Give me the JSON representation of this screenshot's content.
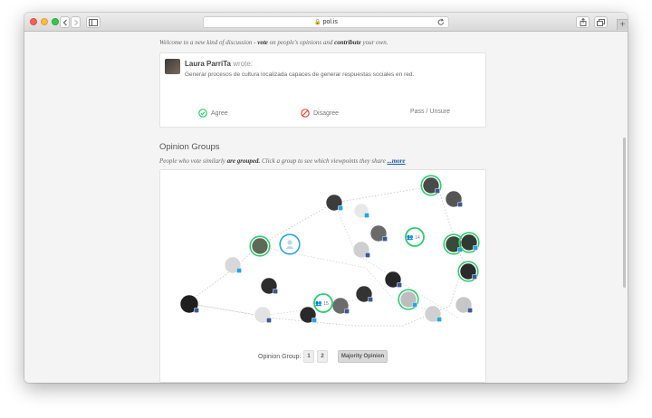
{
  "browser": {
    "url": "pol.is",
    "new_tab": "+"
  },
  "intro": {
    "prefix": "Welcome to a new kind of discussion - ",
    "vote": "vote",
    "middle": " on people's opinions and ",
    "contribute": "contribute",
    "suffix": " your own."
  },
  "comment": {
    "author": "Laura ParriTa",
    "wrote": " wrote:",
    "text": "Generar procesos de cultura localizada capaces de generar respuestas sociales en red.",
    "agree_label": "Agree",
    "disagree_label": "Disagree",
    "pass_label": "Pass / Unsure"
  },
  "opinion_groups": {
    "title": "Opinion Groups",
    "desc_prefix": "People who vote similarly ",
    "desc_bold": "are grouped.",
    "desc_suffix": " Click a group to see which viewpoints they share ",
    "more_link": "...more",
    "selector_label": "Opinion Group:",
    "groups": [
      "1",
      "2"
    ],
    "majority_label": "Majority Opinion",
    "cluster_counts": [
      "14",
      "15"
    ]
  },
  "colors": {
    "accent_green": "#2ecc71",
    "accent_blue": "#2aa3e0",
    "facebook_blue": "#3b5998",
    "disagree_red": "#e74c3c",
    "link_blue": "#1a5aa5"
  },
  "icons": {
    "agree": "check-circle-icon",
    "disagree": "prohibited-icon",
    "cluster": "people-icon",
    "social": "facebook-icon"
  }
}
